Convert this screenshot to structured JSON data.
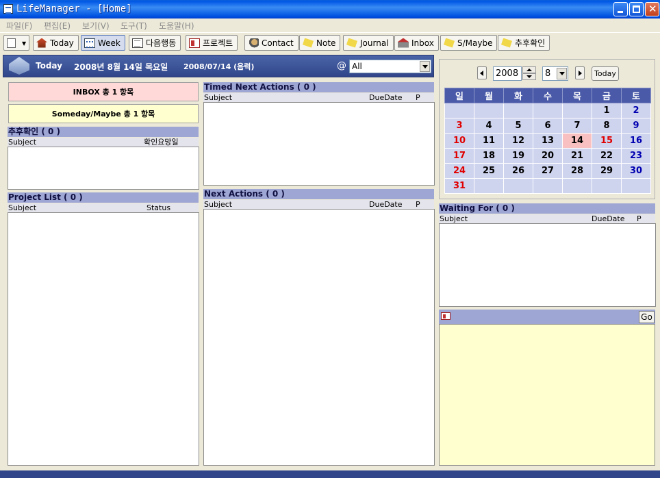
{
  "window": {
    "title": "LifeManager - [Home]"
  },
  "menu": [
    "파일(F)",
    "편집(E)",
    "보기(V)",
    "도구(T)",
    "도움말(H)"
  ],
  "toolbar": {
    "today": "Today",
    "week": "Week",
    "next_actions": "다음행동",
    "projects": "프로젝트",
    "contact": "Contact",
    "note": "Note",
    "journal": "Journal",
    "inbox": "Inbox",
    "smaybe": "S/Maybe",
    "followup": "추후확인"
  },
  "header": {
    "label": "Today",
    "date": "2008년 8월 14일 목요일",
    "lunar": "2008/07/14 (음력)",
    "at": "@",
    "context_value": "All"
  },
  "summary": {
    "inbox": "INBOX 총 1 항목",
    "someday": "Someday/Maybe 총 1 항목"
  },
  "followup": {
    "title": "추후확인 ( 0 )",
    "col_subject": "Subject",
    "col_date": "확인요망일"
  },
  "projects": {
    "title": "Project List ( 0 )",
    "col_subject": "Subject",
    "col_status": "Status"
  },
  "timed": {
    "title": "Timed Next Actions ( 0 )",
    "col_subject": "Subject",
    "col_due": "DueDate",
    "col_p": "P"
  },
  "next": {
    "title": "Next Actions ( 0 )",
    "col_subject": "Subject",
    "col_due": "DueDate",
    "col_p": "P"
  },
  "waiting": {
    "title": "Waiting For ( 0 )",
    "col_subject": "Subject",
    "col_due": "DueDate",
    "col_p": "P"
  },
  "calendar": {
    "year": "2008",
    "month": "8",
    "today_label": "Today",
    "weekdays": [
      "일",
      "월",
      "화",
      "수",
      "목",
      "금",
      "토"
    ],
    "weeks": [
      [
        "",
        "",
        "",
        "",
        "",
        "1",
        "2"
      ],
      [
        "3",
        "4",
        "5",
        "6",
        "7",
        "8",
        "9"
      ],
      [
        "10",
        "11",
        "12",
        "13",
        "14",
        "15",
        "16"
      ],
      [
        "17",
        "18",
        "19",
        "20",
        "21",
        "22",
        "23"
      ],
      [
        "24",
        "25",
        "26",
        "27",
        "28",
        "29",
        "30"
      ],
      [
        "31",
        "",
        "",
        "",
        "",
        "",
        ""
      ]
    ],
    "today_day": "14",
    "holidays": [
      "15"
    ]
  },
  "memo": {
    "go_label": "Go"
  }
}
